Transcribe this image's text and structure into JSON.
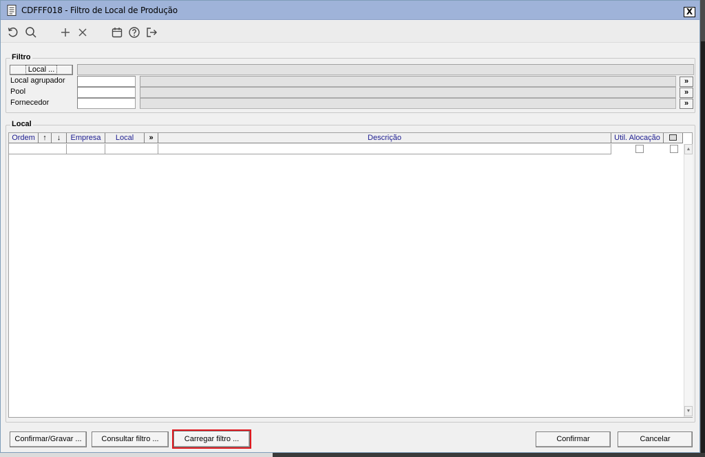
{
  "window": {
    "title": "CDFFF018 - Filtro de Local de Produção",
    "close_label": "X"
  },
  "toolbar": {
    "icons": [
      "refresh-icon",
      "search-icon",
      "add-icon",
      "delete-icon",
      "calendar-icon",
      "help-icon",
      "exit-icon"
    ]
  },
  "filtro": {
    "legend": "Filtro",
    "local_button": "Local ...",
    "local_agrupador_label": "Local agrupador",
    "pool_label": "Pool",
    "fornecedor_label": "Fornecedor",
    "lookup_button": "»",
    "local_value": "",
    "local_agrupador_value": "",
    "pool_value": "",
    "fornecedor_value": ""
  },
  "local": {
    "legend": "Local",
    "columns": {
      "ordem": "Ordem",
      "sort_up": "↑",
      "sort_down": "↓",
      "empresa": "Empresa",
      "local": "Local",
      "expand": "»",
      "descricao": "Descrição",
      "util_alocacao": "Util. Alocação"
    },
    "rows": [
      {
        "ordem": "",
        "empresa": "",
        "local": "",
        "descricao": "",
        "util_alocacao": false,
        "selected": false
      }
    ]
  },
  "footer": {
    "confirmar_gravar": "Confirmar/Gravar ...",
    "consultar_filtro": "Consultar filtro ...",
    "carregar_filtro": "Carregar filtro ...",
    "confirmar": "Confirmar",
    "cancelar": "Cancelar"
  },
  "colors": {
    "titlebar": "#9fb3d9",
    "header_text": "#1b1b8f",
    "highlight": "#e0191f"
  }
}
